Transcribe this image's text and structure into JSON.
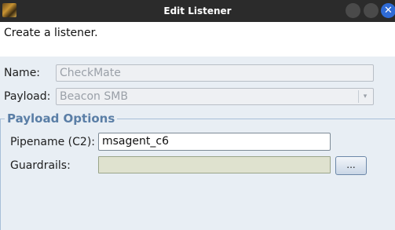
{
  "window": {
    "title": "Edit Listener",
    "close_glyph": "✕"
  },
  "description": "Create a listener.",
  "form": {
    "name_label": "Name:",
    "name_value": "CheckMate",
    "payload_label": "Payload:",
    "payload_value": "Beacon SMB",
    "dropdown_glyph": "▾"
  },
  "payload_options": {
    "section_title": "Payload Options",
    "pipename_label": "Pipename (C2):",
    "pipename_value": "msagent_c6",
    "guardrails_label": "Guardrails:",
    "guardrails_value": "",
    "browse_label": "..."
  },
  "colors": {
    "titlebar": "#2b2b2b",
    "section_title": "#5a7ea6",
    "close_button": "#2f6bd6"
  }
}
